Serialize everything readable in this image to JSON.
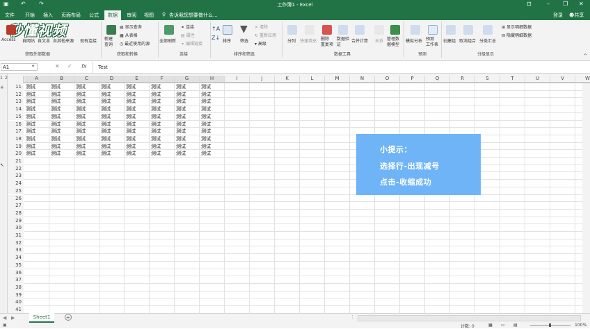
{
  "window": {
    "title": "工作簿1 - Excel",
    "login": "登录",
    "share": "共享"
  },
  "tabs": [
    "文件",
    "开始",
    "插入",
    "页面布局",
    "公式",
    "数据",
    "审阅",
    "视图"
  ],
  "active_tab": "数据",
  "tell_me": "告诉我您想要做什么...",
  "watermark_logo": "秒懂视频",
  "ribbon": {
    "ext": [
      "Access",
      "自网站",
      "自文本",
      "自其他来源",
      "现有连接"
    ],
    "get_transform": [
      "新建\n查询",
      "显示查询",
      "从表格",
      "最近使用的源"
    ],
    "refresh": "全部刷新",
    "connections": [
      "连接",
      "属性",
      "编辑链接"
    ],
    "sort_asc": "Z↓",
    "sort": "排序",
    "filter": "筛选",
    "filter_opts": [
      "清除",
      "重新应用",
      "高级"
    ],
    "tools": [
      "分列",
      "快速填充",
      "删除\n重复项",
      "数据验\n证",
      "合并计算",
      "关系",
      "管理数\n据模型"
    ],
    "forecast": [
      "模拟分析",
      "预测\n工作表"
    ],
    "outline": [
      "创建组",
      "取消组合",
      "分类汇总"
    ],
    "outline_opts": [
      "显示明细数据",
      "隐藏明细数据"
    ],
    "groups": [
      "获取外部数据",
      "获取和转换",
      "连接",
      "排序和筛选",
      "数据工具",
      "预测",
      "分级显示"
    ]
  },
  "formula_bar": {
    "name_box": "A1",
    "fx": "fx",
    "value": "Test"
  },
  "columns": [
    "A",
    "B",
    "C",
    "D",
    "E",
    "F",
    "G",
    "H",
    "I",
    "J",
    "K",
    "L",
    "M",
    "N",
    "O",
    "P",
    "Q",
    "R",
    "S",
    "T",
    "U",
    "V",
    "W"
  ],
  "rows": [
    "11",
    "12",
    "13",
    "14",
    "15",
    "16",
    "17",
    "18",
    "19",
    "20",
    "21",
    "22",
    "23",
    "24",
    "25",
    "26",
    "27",
    "28",
    "29",
    "30",
    "31",
    "32",
    "33",
    "34",
    "35",
    "36",
    "37",
    "38",
    "39",
    "40",
    "41"
  ],
  "cell_text": "测试",
  "filled_rows": 10,
  "filled_cols": 8,
  "outline_levels": [
    "1",
    "2"
  ],
  "tip": {
    "line1": "小提示：",
    "line2": "选择行-出现减号",
    "line3": "点击-收缩成功"
  },
  "sheet": {
    "name": "Sheet1",
    "add": "+"
  },
  "status": {
    "count": "计数: 0",
    "zoom": "100%"
  },
  "colors": {
    "excel_green": "#217346",
    "tip_bg": "#6fb4f7"
  }
}
